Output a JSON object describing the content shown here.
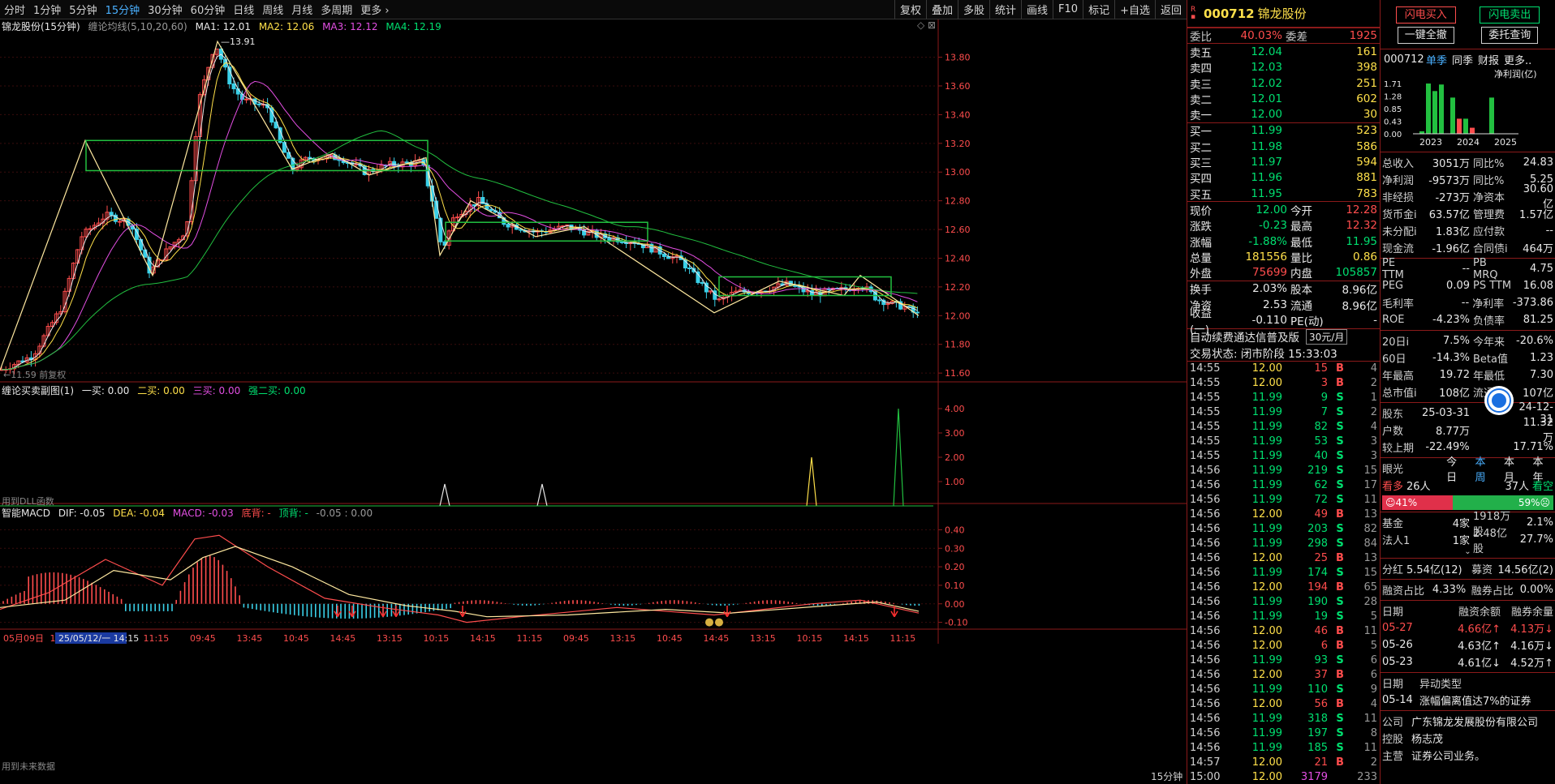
{
  "toolbar": {
    "periods": [
      "分时",
      "1分钟",
      "5分钟",
      "15分钟",
      "30分钟",
      "60分钟",
      "日线",
      "周线",
      "月线",
      "多周期",
      "更多"
    ],
    "active_period": "15分钟",
    "more_icon": "chevron-right-icon",
    "buttons": [
      "复权",
      "叠加",
      "多股",
      "统计",
      "画线",
      "F10",
      "标记",
      "+自选",
      "返回"
    ]
  },
  "chart": {
    "stock_label": "锦龙股份(15分钟)",
    "ma_indicator": "缠论均线(5,10,20,60)",
    "ma1": "MA1: 12.01",
    "ma2": "MA2: 12.06",
    "ma3": "MA3: 12.12",
    "ma4": "MA4: 12.19",
    "high_label": "13.91",
    "low_label": "11.59",
    "low_sub_label": "前复权",
    "sub1_title": "缠论买卖副图(1)",
    "sub1_b1": "一买: 0.00",
    "sub1_b2": "二买: 0.00",
    "sub1_b3": "三买: 0.00",
    "sub1_b4": "强二买: 0.00",
    "sub1_note": "用到DLL函数",
    "macd_title": "智能MACD",
    "macd_dif": "DIF: -0.05",
    "macd_dea": "DEA: -0.04",
    "macd_val": "MACD: -0.03",
    "macd_dibei": "底背: -",
    "macd_dingbei": "顶背: -",
    "macd_extra": "-0.05 : 0.00",
    "macd_note": "用到未来数据",
    "period_badge": "15分钟",
    "cursor_time": "25/05/12/一 14:15",
    "time_labels": [
      "05月09日",
      "13:15",
      "14:15",
      "11:15",
      "09:45",
      "13:45",
      "10:45",
      "14:45",
      "13:15",
      "10:15",
      "14:15",
      "11:15",
      "09:45",
      "13:15",
      "10:45",
      "14:45",
      "13:15",
      "10:15",
      "14:15",
      "11:15"
    ],
    "price_ticks": [
      "13.80",
      "13.60",
      "13.40",
      "13.20",
      "13.00",
      "12.80",
      "12.60",
      "12.40",
      "12.20",
      "12.00",
      "11.80",
      "11.60"
    ],
    "sub1_ticks": [
      "4.00",
      "3.00",
      "2.00",
      "1.00"
    ],
    "macd_ticks": [
      "0.40",
      "0.30",
      "0.20",
      "0.10",
      "0.00",
      "-0.10"
    ]
  },
  "chart_data": {
    "type": "candlestick",
    "series": [
      {
        "name": "MA1",
        "last": 12.01
      },
      {
        "name": "MA2",
        "last": 12.06
      },
      {
        "name": "MA3",
        "last": 12.12
      },
      {
        "name": "MA4",
        "last": 12.19
      }
    ],
    "ylim": [
      11.55,
      13.95
    ],
    "high": 13.91,
    "low": 11.59,
    "macd": {
      "dif": -0.05,
      "dea": -0.04,
      "macd": -0.03
    }
  },
  "quote": {
    "code": "000712",
    "name": "锦龙股份",
    "weibi_label": "委比",
    "weibi": "40.03%",
    "weicha_label": "委差",
    "weicha": "1925",
    "asks": [
      {
        "label": "卖五",
        "price": "12.04",
        "vol": "161"
      },
      {
        "label": "卖四",
        "price": "12.03",
        "vol": "398"
      },
      {
        "label": "卖三",
        "price": "12.02",
        "vol": "251"
      },
      {
        "label": "卖二",
        "price": "12.01",
        "vol": "602"
      },
      {
        "label": "卖一",
        "price": "12.00",
        "vol": "30"
      }
    ],
    "bids": [
      {
        "label": "买一",
        "price": "11.99",
        "vol": "523"
      },
      {
        "label": "买二",
        "price": "11.98",
        "vol": "586"
      },
      {
        "label": "买三",
        "price": "11.97",
        "vol": "594"
      },
      {
        "label": "买四",
        "price": "11.96",
        "vol": "881"
      },
      {
        "label": "买五",
        "price": "11.95",
        "vol": "783"
      }
    ],
    "stats": [
      {
        "l": "现价",
        "v": "12.00",
        "vc": "green",
        "l2": "今开",
        "v2": "12.28",
        "v2c": "red"
      },
      {
        "l": "涨跌",
        "v": "-0.23",
        "vc": "green",
        "l2": "最高",
        "v2": "12.32",
        "v2c": "red"
      },
      {
        "l": "涨幅",
        "v": "-1.88%",
        "vc": "green",
        "l2": "最低",
        "v2": "11.95",
        "v2c": "green"
      },
      {
        "l": "总量",
        "v": "181556",
        "vc": "yel",
        "l2": "量比",
        "v2": "0.86",
        "v2c": "yel"
      },
      {
        "l": "外盘",
        "v": "75699",
        "vc": "red",
        "l2": "内盘",
        "v2": "105857",
        "v2c": "green"
      }
    ],
    "stats2": [
      {
        "l": "换手",
        "v": "2.03%",
        "l2": "股本",
        "v2": "8.96亿"
      },
      {
        "l": "净资",
        "v": "2.53",
        "l2": "流通",
        "v2": "8.96亿"
      },
      {
        "l": "收益(一)",
        "v": "-0.110",
        "l2": "PE(动)",
        "v2": "-"
      }
    ],
    "promo": "自动续费通达信普及版",
    "promo_price": "30元/月",
    "trade_status": "交易状态: 闭市阶段 15:33:03",
    "ticks": [
      {
        "t": "14:55",
        "p": "12.00",
        "v": "15",
        "f": "B",
        "n": "4"
      },
      {
        "t": "14:55",
        "p": "12.00",
        "v": "3",
        "f": "B",
        "n": "2"
      },
      {
        "t": "14:55",
        "p": "11.99",
        "v": "9",
        "f": "S",
        "n": "1"
      },
      {
        "t": "14:55",
        "p": "11.99",
        "v": "7",
        "f": "S",
        "n": "2"
      },
      {
        "t": "14:55",
        "p": "11.99",
        "v": "82",
        "f": "S",
        "n": "4"
      },
      {
        "t": "14:55",
        "p": "11.99",
        "v": "53",
        "f": "S",
        "n": "3"
      },
      {
        "t": "14:55",
        "p": "11.99",
        "v": "40",
        "f": "S",
        "n": "3"
      },
      {
        "t": "14:56",
        "p": "11.99",
        "v": "219",
        "f": "S",
        "n": "15"
      },
      {
        "t": "14:56",
        "p": "11.99",
        "v": "62",
        "f": "S",
        "n": "17"
      },
      {
        "t": "14:56",
        "p": "11.99",
        "v": "72",
        "f": "S",
        "n": "11"
      },
      {
        "t": "14:56",
        "p": "12.00",
        "v": "49",
        "f": "B",
        "n": "13"
      },
      {
        "t": "14:56",
        "p": "11.99",
        "v": "203",
        "f": "S",
        "n": "82"
      },
      {
        "t": "14:56",
        "p": "11.99",
        "v": "298",
        "f": "S",
        "n": "84"
      },
      {
        "t": "14:56",
        "p": "12.00",
        "v": "25",
        "f": "B",
        "n": "13"
      },
      {
        "t": "14:56",
        "p": "11.99",
        "v": "174",
        "f": "S",
        "n": "15"
      },
      {
        "t": "14:56",
        "p": "12.00",
        "v": "194",
        "f": "B",
        "n": "65"
      },
      {
        "t": "14:56",
        "p": "11.99",
        "v": "190",
        "f": "S",
        "n": "28"
      },
      {
        "t": "14:56",
        "p": "11.99",
        "v": "19",
        "f": "S",
        "n": "5"
      },
      {
        "t": "14:56",
        "p": "12.00",
        "v": "46",
        "f": "B",
        "n": "11"
      },
      {
        "t": "14:56",
        "p": "12.00",
        "v": "6",
        "f": "B",
        "n": "5"
      },
      {
        "t": "14:56",
        "p": "11.99",
        "v": "93",
        "f": "S",
        "n": "6"
      },
      {
        "t": "14:56",
        "p": "12.00",
        "v": "37",
        "f": "B",
        "n": "6"
      },
      {
        "t": "14:56",
        "p": "11.99",
        "v": "110",
        "f": "S",
        "n": "9"
      },
      {
        "t": "14:56",
        "p": "12.00",
        "v": "56",
        "f": "B",
        "n": "4"
      },
      {
        "t": "14:56",
        "p": "11.99",
        "v": "318",
        "f": "S",
        "n": "11"
      },
      {
        "t": "14:56",
        "p": "11.99",
        "v": "197",
        "f": "S",
        "n": "8"
      },
      {
        "t": "14:56",
        "p": "11.99",
        "v": "185",
        "f": "S",
        "n": "11"
      },
      {
        "t": "14:57",
        "p": "12.00",
        "v": "21",
        "f": "B",
        "n": "2"
      },
      {
        "t": "15:00",
        "p": "12.00",
        "v": "3179",
        "f": "",
        "n": "233"
      }
    ]
  },
  "f10": {
    "btn_buy": "闪电买入",
    "btn_sell": "闪电卖出",
    "btn_cancel_all": "一键全撤",
    "btn_orders": "委托查询",
    "code": "000712",
    "tabs": [
      "单季",
      "同季",
      "财报",
      "更多.."
    ],
    "chart_title": "净利润(亿)",
    "chart_yticks": [
      "1.71",
      "1.28",
      "0.85",
      "0.43",
      "0.00"
    ],
    "chart_years": [
      "2023",
      "2024",
      "2025"
    ],
    "fin": [
      {
        "a": "总收入",
        "b": "3051万",
        "c": "同比%",
        "d": "24.83"
      },
      {
        "a": "净利润",
        "b": "-9573万",
        "c": "同比%",
        "d": "5.25"
      },
      {
        "a": "非经损",
        "b": "-273万",
        "c": "净资本",
        "d": "30.60亿"
      },
      {
        "a": "货币金i",
        "b": "63.57亿",
        "c": "管理费",
        "d": "1.57亿"
      },
      {
        "a": "未分配i",
        "b": "1.83亿",
        "c": "应付款",
        "d": "--"
      },
      {
        "a": "现金流",
        "b": "-1.96亿",
        "c": "合同债i",
        "d": "464万"
      }
    ],
    "val": [
      {
        "a": "PE TTM",
        "b": "--",
        "c": "PB MRQ",
        "d": "4.75"
      },
      {
        "a": "PEG",
        "b": "0.09",
        "c": "PS TTM",
        "d": "16.08"
      },
      {
        "a": "毛利率",
        "b": "--",
        "c": "净利率",
        "d": "-373.86"
      },
      {
        "a": "ROE",
        "b": "-4.23%",
        "c": "负债率",
        "d": "81.25"
      }
    ],
    "perf": [
      {
        "a": "20日i",
        "b": "7.5%",
        "c": "今年来",
        "d": "-20.6%"
      },
      {
        "a": "60日",
        "b": "-14.3%",
        "c": "Beta值",
        "d": "1.23"
      },
      {
        "a": "年最高",
        "b": "19.72",
        "c": "年最低",
        "d": "7.30"
      },
      {
        "a": "总市值i",
        "b": "108亿",
        "c": "流通值",
        "d": "107亿"
      }
    ],
    "holders": [
      {
        "a": "股东",
        "b": "25-03-31",
        "c": "",
        "d": "24-12-31"
      },
      {
        "a": "户数",
        "b": "8.77万",
        "c": "",
        "d": "11.32万"
      },
      {
        "a": "较上期",
        "b": "-22.49%",
        "c": "",
        "d": "17.71%"
      }
    ],
    "eye_label": "眼光",
    "eye_tabs": [
      "今日",
      "本周",
      "本月",
      "本年"
    ],
    "bull_label": "看多",
    "bull_count": "26人",
    "bear_count": "37人",
    "bear_label": "看空",
    "bull_pct": "41%",
    "bear_pct": "59%",
    "bull_ratio": 0.41,
    "inst": [
      {
        "a": "基金",
        "b": "4家",
        "c": "1918万股",
        "d": "2.1%"
      },
      {
        "a": "法人1",
        "b": "1家",
        "c": "2.48亿股",
        "d": "27.7%"
      }
    ],
    "div_label": "分红",
    "div_value": "5.54亿(12)",
    "raise_label": "募资",
    "raise_value": "14.56亿(2)",
    "margin_label": "融资占比",
    "margin_value": "4.33%",
    "short_label": "融券占比",
    "short_value": "0.00%",
    "margin_head": [
      "日期",
      "融资余额",
      "融券余量"
    ],
    "margin_rows": [
      {
        "d": "05-27",
        "a": "4.66亿↑",
        "b": "4.13万↓"
      },
      {
        "d": "05-26",
        "a": "4.63亿↑",
        "b": "4.16万↓"
      },
      {
        "d": "05-23",
        "a": "4.61亿↓",
        "b": "4.52万↑"
      }
    ],
    "event_head": [
      "日期",
      "异动类型"
    ],
    "event_date": "05-14",
    "event_text": "涨幅偏离值达7%的证券",
    "company_label": "公司",
    "company": "广东锦龙发展股份有限公司",
    "control_label": "控股",
    "control": "杨志茂",
    "main_label": "主营",
    "main": "证券公司业务。"
  }
}
